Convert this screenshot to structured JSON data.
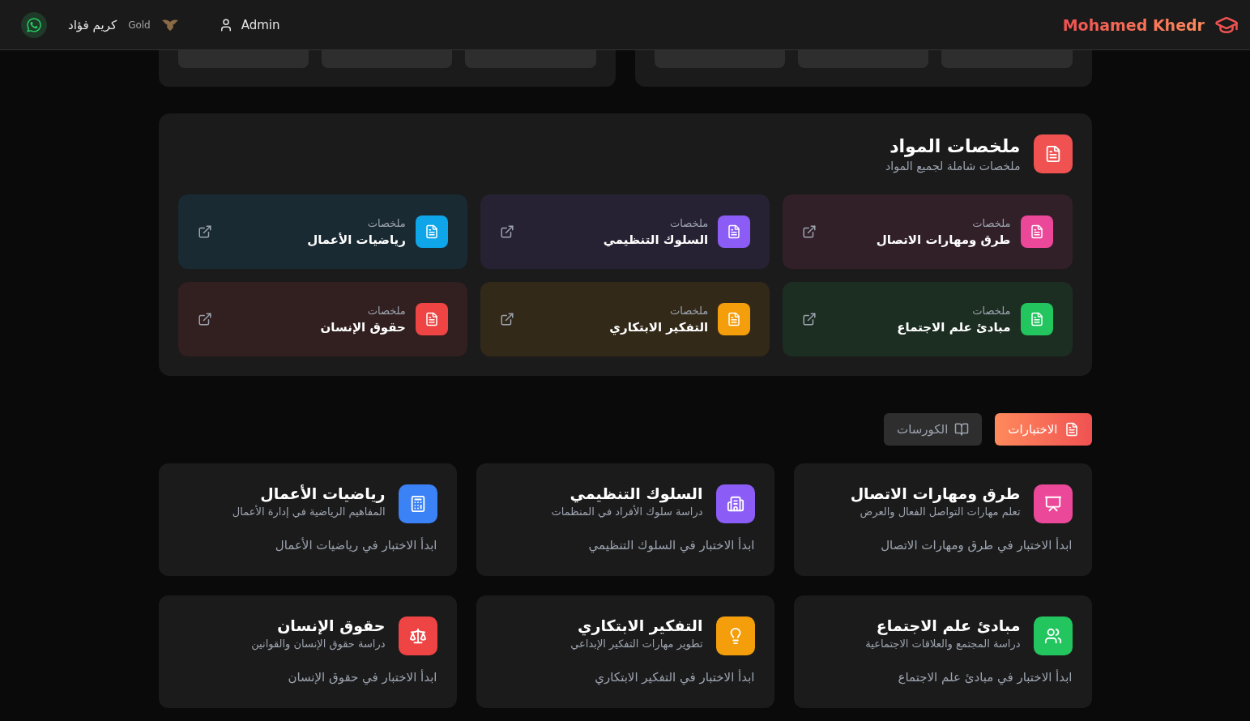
{
  "header": {
    "brand": "Mohamed Khedr",
    "user": "Admin",
    "student": {
      "name": "كريم فؤاد",
      "tier": "Gold"
    }
  },
  "summaries": {
    "title": "ملخصات المواد",
    "subtitle": "ملخصات شاملة لجميع المواد",
    "items": [
      {
        "label": "ملخصات",
        "name": "طرق ومهارات الاتصال",
        "color": "#ec4899"
      },
      {
        "label": "ملخصات",
        "name": "السلوك التنظيمي",
        "color": "#8b5cf6"
      },
      {
        "label": "ملخصات",
        "name": "رياضيات الأعمال",
        "color": "#0ea5e9"
      },
      {
        "label": "ملخصات",
        "name": "مبادئ علم الاجتماع",
        "color": "#22c55e"
      },
      {
        "label": "ملخصات",
        "name": "التفكير الابتكاري",
        "color": "#f59e0b"
      },
      {
        "label": "ملخصات",
        "name": "حقوق الإنسان",
        "color": "#ef4444"
      }
    ]
  },
  "tabs": [
    {
      "label": "الاختبارات",
      "selected": true
    },
    {
      "label": "الكورسات",
      "selected": false
    }
  ],
  "tests": [
    {
      "title": "طرق ومهارات الاتصال",
      "description": "تعلم مهارات التواصل الفعال والعرض",
      "action": "ابدأ الاختبار في طرق ومهارات الاتصال",
      "color": "#ec4899"
    },
    {
      "title": "السلوك التنظيمي",
      "description": "دراسة سلوك الأفراد في المنظمات",
      "action": "ابدأ الاختبار في السلوك التنظيمي",
      "color": "#8b5cf6"
    },
    {
      "title": "رياضيات الأعمال",
      "description": "المفاهيم الرياضية في إدارة الأعمال",
      "action": "ابدأ الاختبار في رياضيات الأعمال",
      "color": "#3b82f6"
    },
    {
      "title": "مبادئ علم الاجتماع",
      "description": "دراسة المجتمع والعلاقات الاجتماعية",
      "action": "ابدأ الاختبار في مبادئ علم الاجتماع",
      "color": "#22c55e"
    },
    {
      "title": "التفكير الابتكاري",
      "description": "تطوير مهارات التفكير الإبداعي",
      "action": "ابدأ الاختبار في التفكير الابتكاري",
      "color": "#f59e0b"
    },
    {
      "title": "حقوق الإنسان",
      "description": "دراسة حقوق الإنسان والقوانين",
      "action": "ابدأ الاختبار في حقوق الإنسان",
      "color": "#ef4444"
    }
  ]
}
